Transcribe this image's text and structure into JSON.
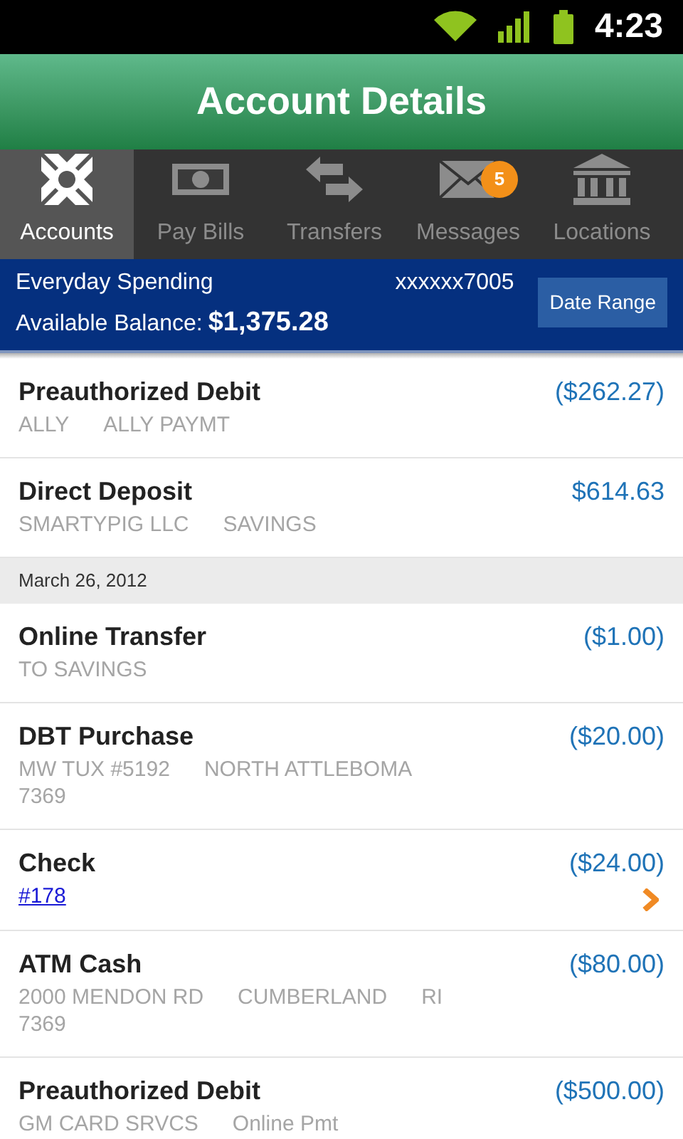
{
  "status_bar": {
    "time": "4:23"
  },
  "header": {
    "title": "Account Details"
  },
  "tabs": [
    {
      "label": "Accounts",
      "selected": true
    },
    {
      "label": "Pay Bills",
      "selected": false
    },
    {
      "label": "Transfers",
      "selected": false
    },
    {
      "label": "Messages",
      "selected": false,
      "badge": "5"
    },
    {
      "label": "Locations",
      "selected": false
    }
  ],
  "account": {
    "name": "Everyday Spending",
    "number": "xxxxxx7005",
    "balance_label": "Available Balance:",
    "balance": "$1,375.28",
    "button": "Date Range"
  },
  "items": [
    {
      "kind": "transaction",
      "title": "Preauthorized Debit",
      "amount": "($262.27)",
      "lines": [
        [
          "ALLY",
          "ALLY PAYMT"
        ]
      ],
      "chevron": false
    },
    {
      "kind": "transaction",
      "title": "Direct Deposit",
      "amount": "$614.63",
      "lines": [
        [
          "SMARTYPIG LLC",
          "SAVINGS"
        ]
      ],
      "chevron": false
    },
    {
      "kind": "date",
      "label": "March 26, 2012"
    },
    {
      "kind": "transaction",
      "title": "Online Transfer",
      "amount": "($1.00)",
      "lines": [
        [
          "TO SAVINGS"
        ]
      ],
      "chevron": false
    },
    {
      "kind": "transaction",
      "title": "DBT Purchase",
      "amount": "($20.00)",
      "lines": [
        [
          "MW TUX #5192",
          "NORTH ATTLEBOMA"
        ],
        [
          "7369"
        ]
      ],
      "chevron": false
    },
    {
      "kind": "transaction",
      "title": "Check",
      "amount": "($24.00)",
      "link": "#178",
      "chevron": true
    },
    {
      "kind": "transaction",
      "title": "ATM Cash",
      "amount": "($80.00)",
      "lines": [
        [
          "2000 MENDON RD",
          "CUMBERLAND",
          "RI"
        ],
        [
          "7369"
        ]
      ],
      "chevron": false
    },
    {
      "kind": "transaction",
      "title": "Preauthorized Debit",
      "amount": "($500.00)",
      "lines": [
        [
          "GM CARD SRVCS",
          "Online Pmt"
        ]
      ],
      "chevron": false
    }
  ]
}
